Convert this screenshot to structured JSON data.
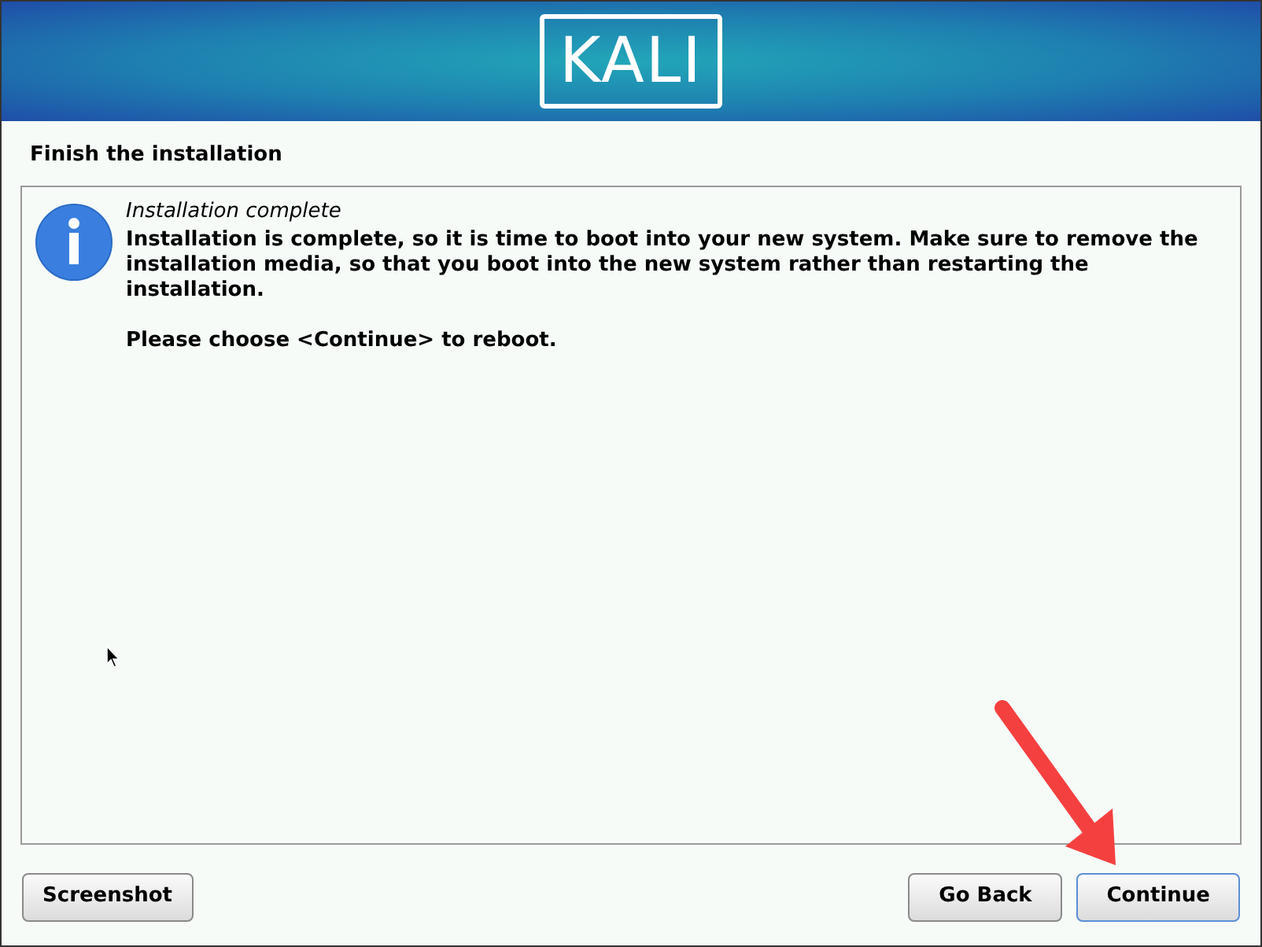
{
  "header": {
    "logo": "KALI"
  },
  "page_title": "Finish the installation",
  "message": {
    "title": "Installation complete",
    "body": "Installation is complete, so it is time to boot into your new system. Make sure to remove the installation media, so that you boot into the new system rather than restarting the installation.",
    "instruction": "Please choose <Continue> to reboot."
  },
  "buttons": [
    {
      "label": "Screenshot",
      "kind": "left",
      "selected": false
    },
    {
      "label": "Go Back",
      "kind": "right",
      "selected": false
    },
    {
      "label": "Continue",
      "kind": "right",
      "selected": true
    }
  ]
}
